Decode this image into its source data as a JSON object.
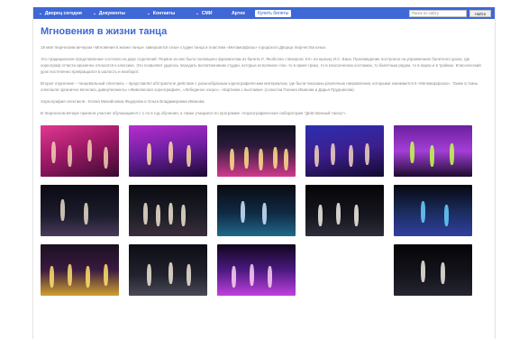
{
  "header": {
    "nav": [
      {
        "label": "Дворец сегодня",
        "has_dropdown": true
      },
      {
        "label": "Документы",
        "has_dropdown": true
      },
      {
        "label": "Контакты",
        "has_dropdown": true
      },
      {
        "label": "СМИ",
        "has_dropdown": true
      },
      {
        "label": "Артек",
        "has_dropdown": false
      }
    ],
    "ticket_label": "Купить билеты",
    "search": {
      "placeholder": "Поиск по сайту",
      "value": "",
      "button_label": "Найти"
    },
    "accent_color": "#3f67d6"
  },
  "article": {
    "title": "Мгновения в жизни танца",
    "paragraphs": [
      "19 мая творческим вечером «Мгновения в жизни танца» завершился сезон студии танца и пластики «Метаморфозы» городского Дворца творчества юных.",
      "Это традиционное представление состояло из двух отделений. Первое из них было посвящено фрагментам из балета Л. Якобсона «Экзерсис XX» на музыку И.С. Баха. Произведение построено на упражнениях балетного урока, где хореограф отчасти иронично относится к классике. Это позволяет удалось передать воспитанникам студии, которые исполнили «па» то в ярких трико, то в классических костюмах, то балетным рядом, то в парах и в тройках. Классический урок постепенно превращался в шалость и наоборот.",
      "Второе отделение – танцевальный спектакль – представлял абстрактное действие с разнообразным хореографическим материалом, где были показаны различные направления, которыми занимаются в «Метаморфозах». Также в ткань спектакля органично вплелись дивертисменты «Живописная хореография», «Лебединое озеро», «Картинки с выставки» (солистки Полина Иванова и Дарья Прудникова).",
      "Хореография спектакля - Елена Михайловна Федорова и Ольга Владимировна Иванова.",
      "В творческом вечере приняли участие обучающиеся с 1 по 6 год обучения, а также учащиеся по программе «Хореографическая лаборатория \"Действенный танец\"»."
    ]
  },
  "gallery": {
    "photos": [
      {
        "name": "photo-1",
        "bg": "linear-gradient(160deg,#e0398f 0%,#a11a6a 45%,#3a0a2e 100%)",
        "accent": "#f0d0b0"
      },
      {
        "name": "photo-2",
        "bg": "linear-gradient(170deg,#b62ecf 0%,#6d1fa0 50%,#1a0a30 100%)",
        "accent": "#ffd8a8"
      },
      {
        "name": "photo-3",
        "bg": "linear-gradient(180deg,#101020 0%,#2a1a3a 40%,#d03a8c 100%)",
        "accent": "#ffe08a"
      },
      {
        "name": "photo-4",
        "bg": "linear-gradient(170deg,#2b2fb0 0%,#3d1f8f 50%,#120a30 100%)",
        "accent": "#f2d5c0"
      },
      {
        "name": "photo-5",
        "bg": "linear-gradient(180deg,#6b1f9e 0%,#a33fd6 50%,#1c0a2e 100%)",
        "accent": "#c6ff4a"
      },
      {
        "name": "photo-6",
        "bg": "linear-gradient(180deg,#0a0a14 0%,#1c1c2c 60%,#4a3a5a 100%)",
        "accent": "#e8dcc8"
      },
      {
        "name": "photo-7",
        "bg": "linear-gradient(180deg,#0a0a10 0%,#1e1e28 60%,#3a2f3a 100%)",
        "accent": "#f0e4d0"
      },
      {
        "name": "photo-8",
        "bg": "linear-gradient(180deg,#0a0a12 0%,#102a44 55%,#1f6a8a 100%)",
        "accent": "#cfe8ff"
      },
      {
        "name": "photo-9",
        "bg": "linear-gradient(180deg,#050508 0%,#16161e 60%,#2e2e3a 100%)",
        "accent": "#f5f0e8"
      },
      {
        "name": "photo-10",
        "bg": "linear-gradient(180deg,#070710 0%,#1a2b5a 50%,#3040a0 100%)",
        "accent": "#6ad0ff"
      },
      {
        "name": "photo-11",
        "bg": "linear-gradient(180deg,#1a1020 0%,#3a1a40 50%,#d0a030 100%)",
        "accent": "#ffe070"
      },
      {
        "name": "photo-12",
        "bg": "linear-gradient(180deg,#0c0c14 0%,#22222e 60%,#4a4a58 100%)",
        "accent": "#f0e6d6"
      },
      {
        "name": "photo-13",
        "bg": "linear-gradient(180deg,#10061c 0%,#4a1a80 50%,#c040e0 100%)",
        "accent": "#ffd0f0"
      },
      {
        "name": "photo-14",
        "bg": "none",
        "accent": "none"
      },
      {
        "name": "photo-15",
        "bg": "linear-gradient(180deg,#050508 0%,#14141c 60%,#262632 100%)",
        "accent": "#f2ece2"
      }
    ]
  }
}
